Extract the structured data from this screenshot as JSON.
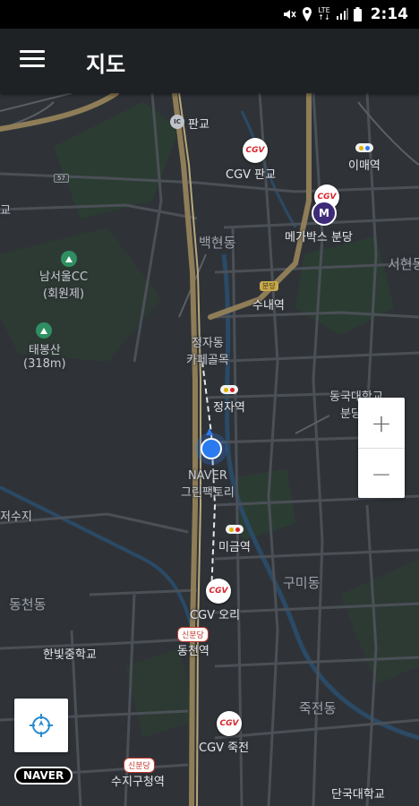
{
  "status_bar": {
    "time": "2:14",
    "network": "LTE",
    "icons": [
      "mute-icon",
      "location-icon",
      "lte-icon",
      "signal-icon",
      "battery-icon"
    ]
  },
  "app_bar": {
    "title": "지도",
    "menu_icon": "hamburger-menu-icon"
  },
  "map": {
    "labels": {
      "pangyo": "판교",
      "cgv_pangyo": "CGV 판교",
      "imae_station": "이매역",
      "megabox_bundang": "메가박스 분당",
      "baekhyeon": "백현동",
      "seohyeon": "서현동",
      "sunae_station": "수내역",
      "namseoul_cc": "남서울CC",
      "namseoul_cc_sub": "(회원제)",
      "taebongsan": "태봉산",
      "taebongsan_height": "(318m)",
      "jeongja_cafe_1": "정자동",
      "jeongja_cafe_2": "카페골목",
      "jeongja_station": "정자역",
      "dankook_1": "동국대학교",
      "dankook_2": "분당한",
      "naver_1": "NAVER",
      "naver_2": "그린팩토리",
      "jeosuji": "저수지",
      "migeum_station": "미금역",
      "gumi": "구미동",
      "dongcheon": "동천동",
      "cgv_ori": "CGV 오리",
      "hanbit_school": "한빛중학교",
      "dongcheon_station": "동천역",
      "jukjeon": "죽전동",
      "cgv_jukjeon": "CGV 죽전",
      "suji_office": "수지구청역",
      "dankook_univ": "단국대학교",
      "ori_left": "교",
      "seohyeon_cut": "서현동"
    },
    "badges": {
      "ic": "IC",
      "route_57": "57",
      "sinbundang_1": "신분당",
      "sinbundang_2": "신분당",
      "bundang": "분당",
      "megabox_mark": "M",
      "cgv_mark": "CGV"
    },
    "colors": {
      "land": "#2f3338",
      "park": "#2b3d33",
      "road": "#4b5057",
      "highway": "#8e7d57",
      "water": "#2a4a66"
    },
    "zoom": {
      "in": "+",
      "out": "−"
    },
    "location_button_icon": "compass-locate-icon",
    "brand": "NAVER"
  }
}
